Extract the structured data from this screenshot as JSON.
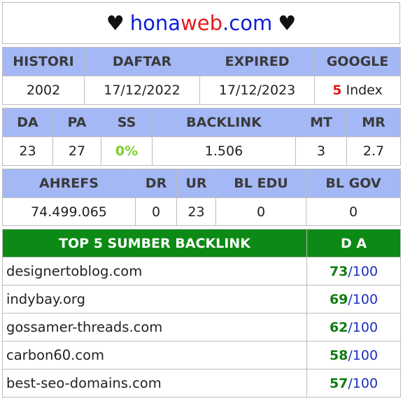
{
  "header": {
    "heart": "♥",
    "brand_a": "hona",
    "brand_b": "web",
    "brand_c": ".com"
  },
  "t1": {
    "cols": [
      "HISTORI",
      "DAFTAR",
      "EXPIRED",
      "GOOGLE"
    ],
    "row": [
      "2002",
      "17/12/2022",
      "17/12/2023"
    ],
    "google_count": "5",
    "google_suffix": " Index"
  },
  "t2": {
    "cols": [
      "DA",
      "PA",
      "SS",
      "BACKLINK",
      "MT",
      "MR"
    ],
    "row": [
      "23",
      "27",
      "0%",
      "1.506",
      "3",
      "2.7"
    ]
  },
  "t3": {
    "cols": [
      "AHREFS",
      "DR",
      "UR",
      "BL EDU",
      "BL GOV"
    ],
    "row": [
      "74.499.065",
      "0",
      "23",
      "0",
      "0"
    ]
  },
  "top": {
    "title": "TOP 5 SUMBER BACKLINK",
    "da_title": "D A",
    "rows": [
      {
        "domain": "designertoblog.com",
        "da": "73",
        "max": "/100"
      },
      {
        "domain": "indybay.org",
        "da": "69",
        "max": "/100"
      },
      {
        "domain": "gossamer-threads.com",
        "da": "62",
        "max": "/100"
      },
      {
        "domain": "carbon60.com",
        "da": "58",
        "max": "/100"
      },
      {
        "domain": "best-seo-domains.com",
        "da": "57",
        "max": "/100"
      }
    ]
  },
  "colors": {
    "header_blue": "#a4b8f5",
    "top_green": "#0d8a15",
    "accent_red": "#e01b1b",
    "brand_blue": "#0b1fd6"
  }
}
